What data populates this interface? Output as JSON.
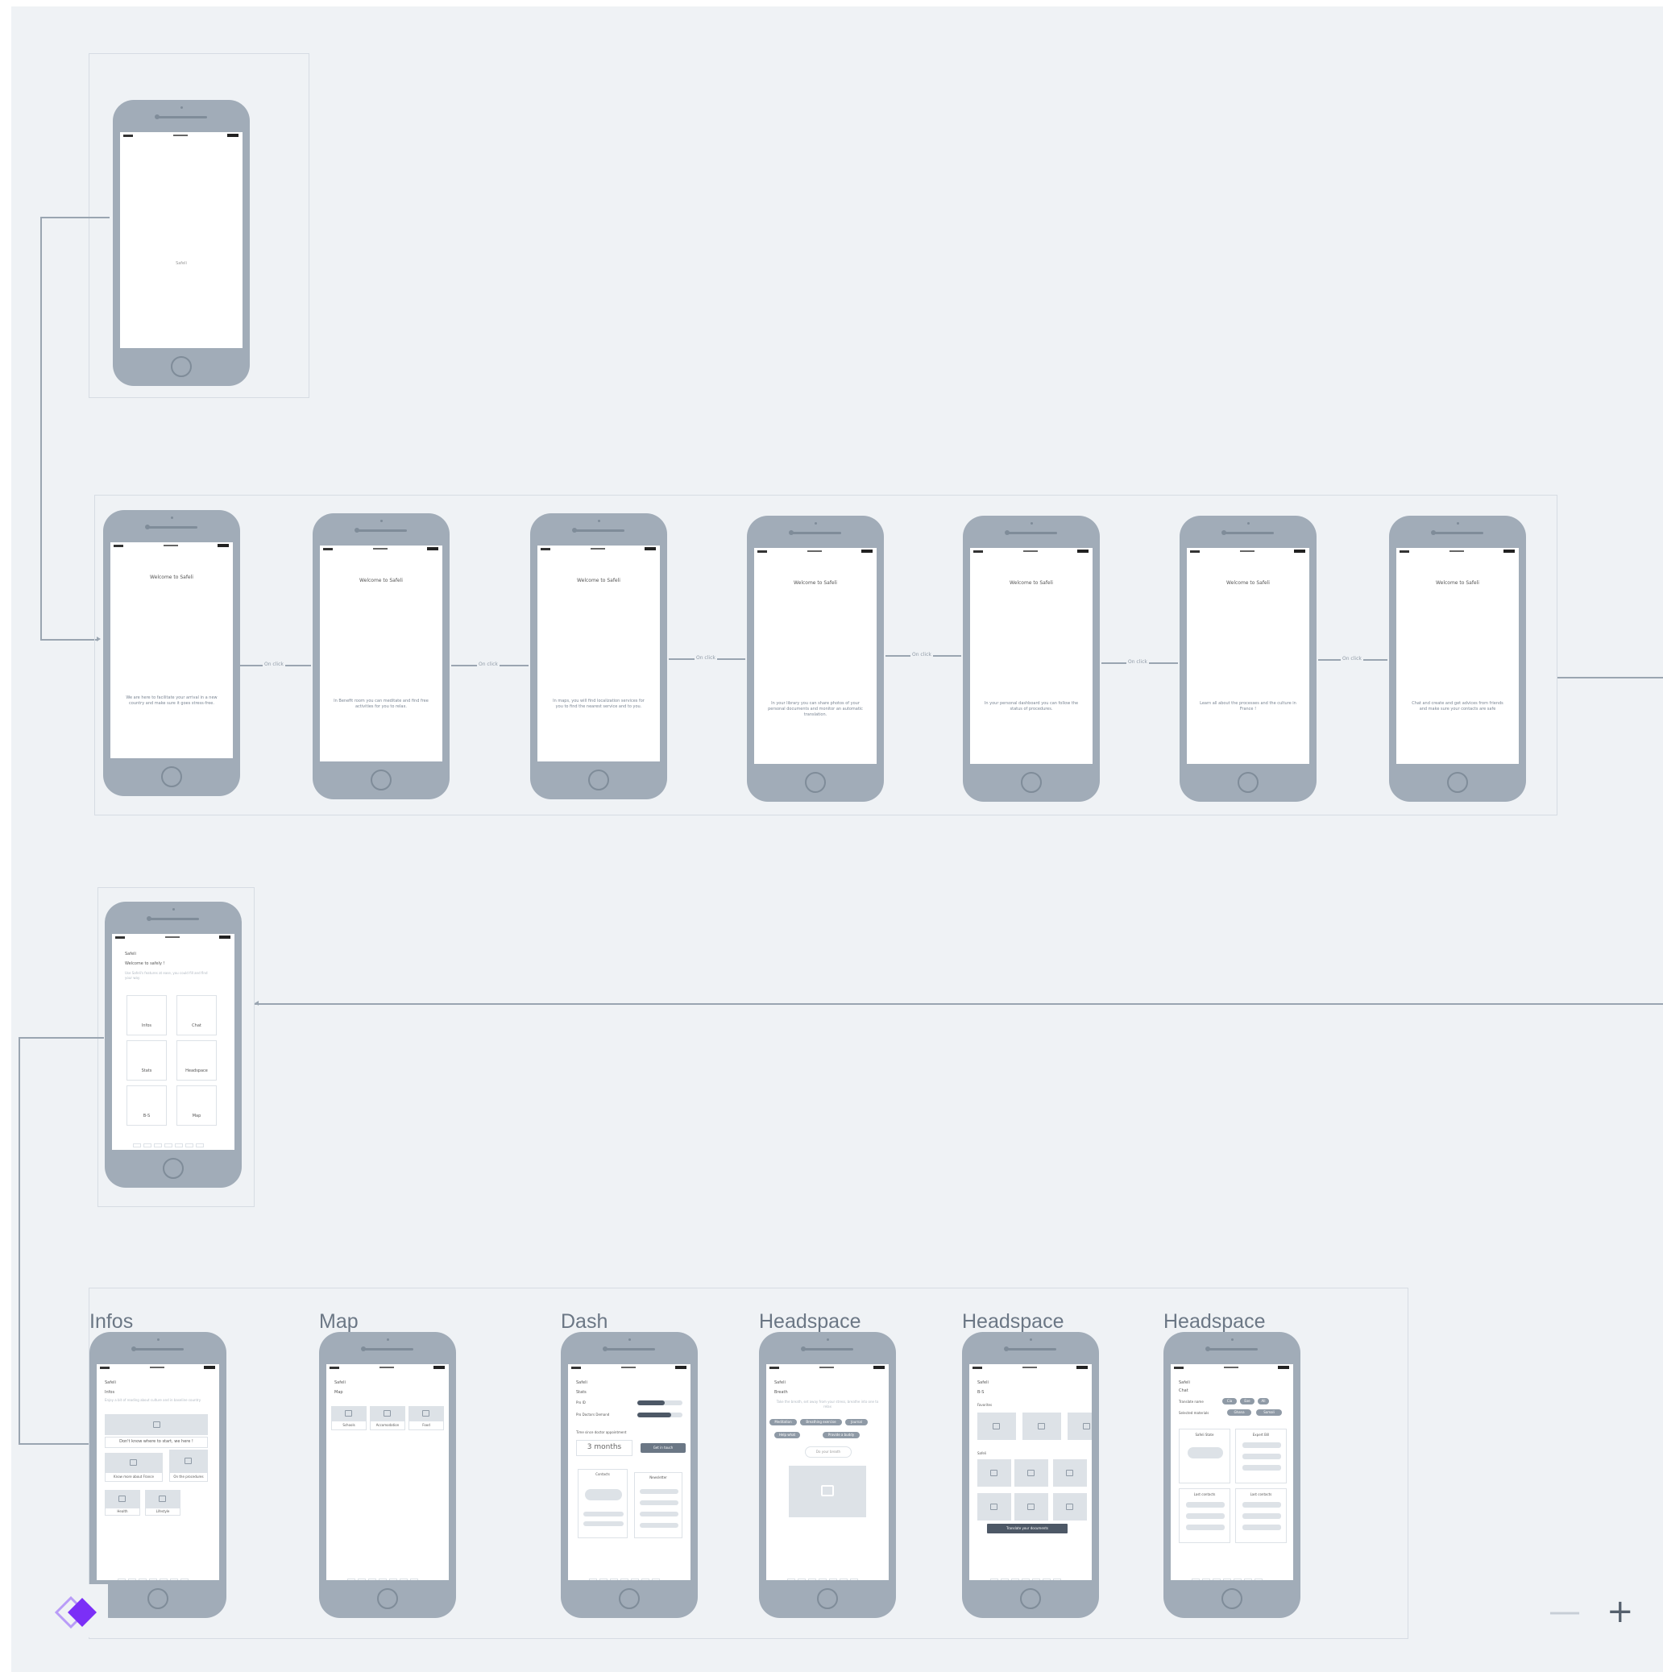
{
  "screens": {
    "splash_text": "Safeli",
    "onboarding_title": "Welcome to Safeli",
    "onboarding_bodies": [
      "We are here to facilitate your arrival in a new country and make sure it goes stress-free.",
      "In Benefit room you can meditate and find free activities for you to relax.",
      "In maps, you will find localization services for you to find the nearest service and to you.",
      "In your library you can share photos of your personal documents and monitor an automatic translation.",
      "In your personal dashboard you can follow the status of procedures.",
      "Learn all about the processes and the culture in France !",
      "Chat and create and get advices from friends and make sure your contacts are safe"
    ],
    "flow_label": "On click",
    "home": {
      "app": "Safeli",
      "welcome": "Welcome to safely !",
      "intro": "Use Safeli's features at ease, you could fill and find your way",
      "tiles": [
        "Infos",
        "Chat",
        "Stats",
        "Headspace",
        "B-S",
        "Map"
      ]
    }
  },
  "bottom_labels": [
    "Infos",
    "Map",
    "Dash",
    "Headspace",
    "Headspace",
    "Headspace"
  ],
  "infos_screen": {
    "app": "Safeli",
    "title": "Infos",
    "desc": "Enjoy a bit of reading about culture and in baseline country",
    "banner": "Don't know where to start, we here !",
    "card1": "Know more about France",
    "card2": "On the procedures",
    "card3": "Health",
    "card4": "Lifestyle"
  },
  "map_screen": {
    "app": "Safeli",
    "title": "Map",
    "c1": "Schools",
    "c2": "Accomodation",
    "c3": "Food"
  },
  "dash_screen": {
    "app": "Safeli",
    "title": "Stats",
    "row1": "Pro ID",
    "row2": "Pro Doctors Demand",
    "label": "Time since doctor appointment",
    "months": "3 months",
    "btn": "Get in touch",
    "card1": "Contacts",
    "card2": "Newsletter"
  },
  "headspace1": {
    "app": "Safeli",
    "title": "Breath",
    "desc": "Take the breath, set away from your stress, breathe into one to relax",
    "chips": [
      "Meditation",
      "Breathing exercise",
      "Journal",
      "Help what",
      "Provide a buddy"
    ],
    "button": "Do your breath"
  },
  "headspace2": {
    "app": "Safeli",
    "title": "B-S",
    "section1": "Favorites",
    "section2": "Safeli",
    "cta": "Translate your documents"
  },
  "headspace3": {
    "app": "Safeli",
    "title": "Chat",
    "row1": "Translate name",
    "row2": "Selected materials",
    "chipsA": [
      "Cia",
      "Exe",
      "All"
    ],
    "chipsB": [
      "Ghana",
      "Somali"
    ],
    "card1": "Safeli State",
    "card2": "Expert Bill",
    "card3": "Last contacts",
    "card4": "Last contacts"
  },
  "zoom": {
    "minus": "—",
    "plus": "+"
  },
  "colors": {
    "canvas": "#eff2f5",
    "device": "#a1acb8",
    "accent": "#7b2ff7"
  }
}
